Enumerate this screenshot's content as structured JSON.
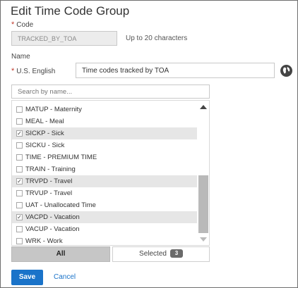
{
  "page": {
    "title": "Edit Time Code Group"
  },
  "code": {
    "label": "Code",
    "value": "TRACKED_BY_TOA",
    "hint": "Up to 20 characters"
  },
  "name": {
    "section_label": "Name",
    "us_english_label": "U.S. English",
    "us_english_value": "Time codes tracked by TOA",
    "globe_icon": "globe-icon"
  },
  "search": {
    "placeholder": "Search by name..."
  },
  "list": {
    "items": [
      {
        "label": "MATUP - Maternity",
        "checked": false
      },
      {
        "label": "MEAL - Meal",
        "checked": false
      },
      {
        "label": "SICKP - Sick",
        "checked": true
      },
      {
        "label": "SICKU - Sick",
        "checked": false
      },
      {
        "label": "TIME - PREMIUM TIME",
        "checked": false
      },
      {
        "label": "TRAIN - Training",
        "checked": false
      },
      {
        "label": "TRVPD - Travel",
        "checked": true
      },
      {
        "label": "TRVUP - Travel",
        "checked": false
      },
      {
        "label": "UAT - Unallocated Time",
        "checked": false
      },
      {
        "label": "VACPD - Vacation",
        "checked": true
      },
      {
        "label": "VACUP - Vacation",
        "checked": false
      },
      {
        "label": "WRK - Work",
        "checked": false
      }
    ]
  },
  "tabs": {
    "all_label": "All",
    "selected_label": "Selected",
    "selected_count": "3"
  },
  "footer": {
    "save_label": "Save",
    "cancel_label": "Cancel"
  },
  "colors": {
    "accent": "#1a73c9",
    "required": "#c0392b",
    "selected_row": "#e6e6e6"
  }
}
